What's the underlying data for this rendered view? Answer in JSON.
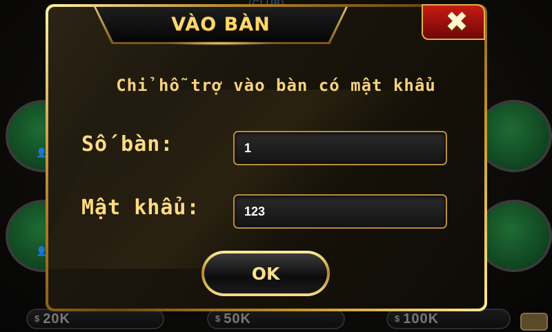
{
  "background": {
    "club_label": "CLUB",
    "bet_pills": [
      {
        "currency": "$",
        "amount": "20K"
      },
      {
        "currency": "$",
        "amount": "50K"
      },
      {
        "currency": "$",
        "amount": "100K"
      }
    ]
  },
  "dialog": {
    "title": "VÀO BÀN",
    "close_glyph": "✖",
    "subtitle": "Chỉ hỗ trợ vào bàn có mật khẩu",
    "table_number": {
      "label": "Số bàn:",
      "value": "1"
    },
    "password": {
      "label": "Mật khẩu:",
      "value": "123"
    },
    "ok_label": "OK"
  },
  "colors": {
    "gold": "#ffdc82",
    "close_red": "#c81a14",
    "table_green": "#1f6b33"
  },
  "icons": [
    "close-icon",
    "person-icon"
  ]
}
